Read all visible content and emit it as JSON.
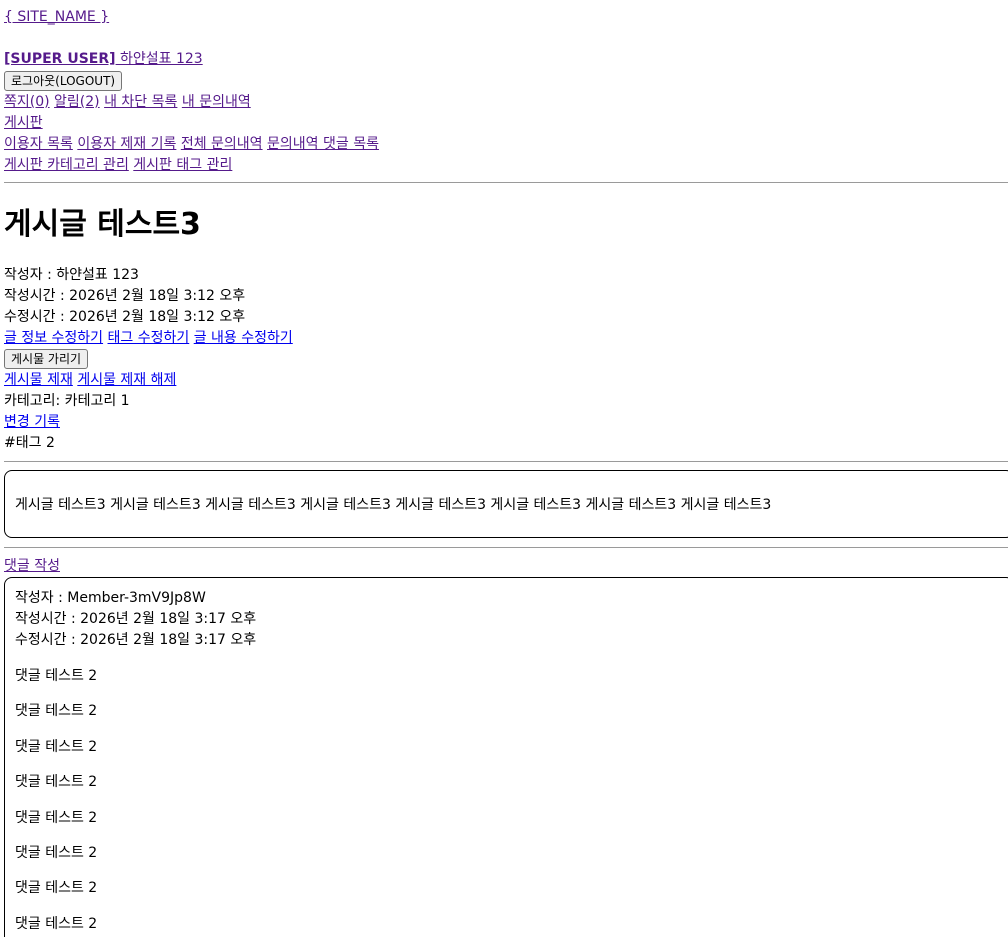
{
  "header": {
    "site_name": "{ SITE_NAME }",
    "user_role": "[SUPER USER]",
    "user_name": " 하얀설표 123",
    "logout_label": "로그아웃(LOGOUT)"
  },
  "nav": {
    "row1": [
      {
        "label": "쪽지(0)"
      },
      {
        "label": "알림(2)"
      },
      {
        "label": "내 차단 목록"
      },
      {
        "label": "내 문의내역"
      }
    ],
    "row2": [
      {
        "label": "게시판"
      }
    ],
    "row3": [
      {
        "label": "이용자 목록"
      },
      {
        "label": "이용자 제재 기록"
      },
      {
        "label": "전체 문의내역"
      },
      {
        "label": "문의내역 댓글 목록"
      }
    ],
    "row4": [
      {
        "label": "게시판 카테고리 관리"
      },
      {
        "label": "게시판 태그 관리"
      }
    ]
  },
  "post": {
    "title": "게시글 테스트3",
    "author_line": "작성자 : 하얀설표 123",
    "created_line": "작성시간 : 2026년 2월 18일 3:12 오후",
    "updated_line": "수정시간 : 2026년 2월 18일 3:12 오후",
    "edit_links": [
      {
        "label": "글 정보 수정하기"
      },
      {
        "label": "태그 수정하기"
      },
      {
        "label": "글 내용 수정하기"
      }
    ],
    "hide_button": "게시물 가리기",
    "moderation_links": [
      {
        "label": "게시물 제재"
      },
      {
        "label": "게시물 제재 해제"
      }
    ],
    "category_line": "카테고리: 카테고리 1",
    "history_link": "변경 기록",
    "tag_line": "#태그 2",
    "content": "게시글 테스트3 게시글 테스트3 게시글 테스트3 게시글 테스트3 게시글 테스트3 게시글 테스트3 게시글 테스트3 게시글 테스트3"
  },
  "comments": {
    "write_link": "댓글 작성",
    "items": [
      {
        "author_line": "작성자 : Member-3mV9Jp8W",
        "created_line": "작성시간 : 2026년 2월 18일 3:17 오후",
        "updated_line": "수정시간 : 2026년 2월 18일 3:17 오후",
        "lines": [
          "댓글 테스트 2",
          "댓글 테스트 2",
          "댓글 테스트 2",
          "댓글 테스트 2",
          "댓글 테스트 2",
          "댓글 테스트 2",
          "댓글 테스트 2",
          "댓글 테스트 2"
        ]
      }
    ]
  }
}
